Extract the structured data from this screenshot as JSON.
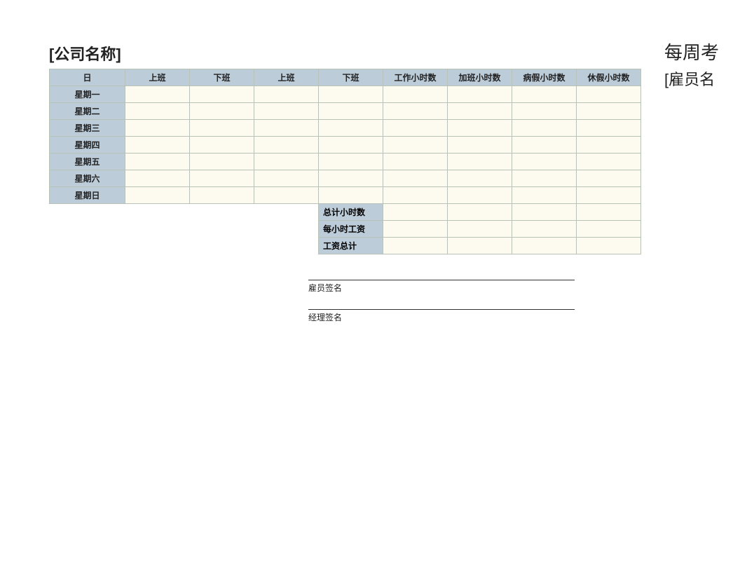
{
  "header": {
    "company_name": "[公司名称]",
    "weekly_title": "每周考",
    "employee_name": "[雇员名"
  },
  "columns": {
    "day": "日",
    "in1": "上班",
    "out1": "下班",
    "in2": "上班",
    "out2": "下班",
    "work_hours": "工作小时数",
    "overtime_hours": "加班小时数",
    "sick_hours": "病假小时数",
    "vacation_hours": "休假小时数"
  },
  "days": [
    "星期一",
    "星期二",
    "星期三",
    "星期四",
    "星期五",
    "星期六",
    "星期日"
  ],
  "summary": {
    "total_hours": "总计小时数",
    "hourly_wage": "每小时工资",
    "total_wage": "工资总计"
  },
  "signatures": {
    "employee": "雇员签名",
    "manager": "经理签名"
  }
}
